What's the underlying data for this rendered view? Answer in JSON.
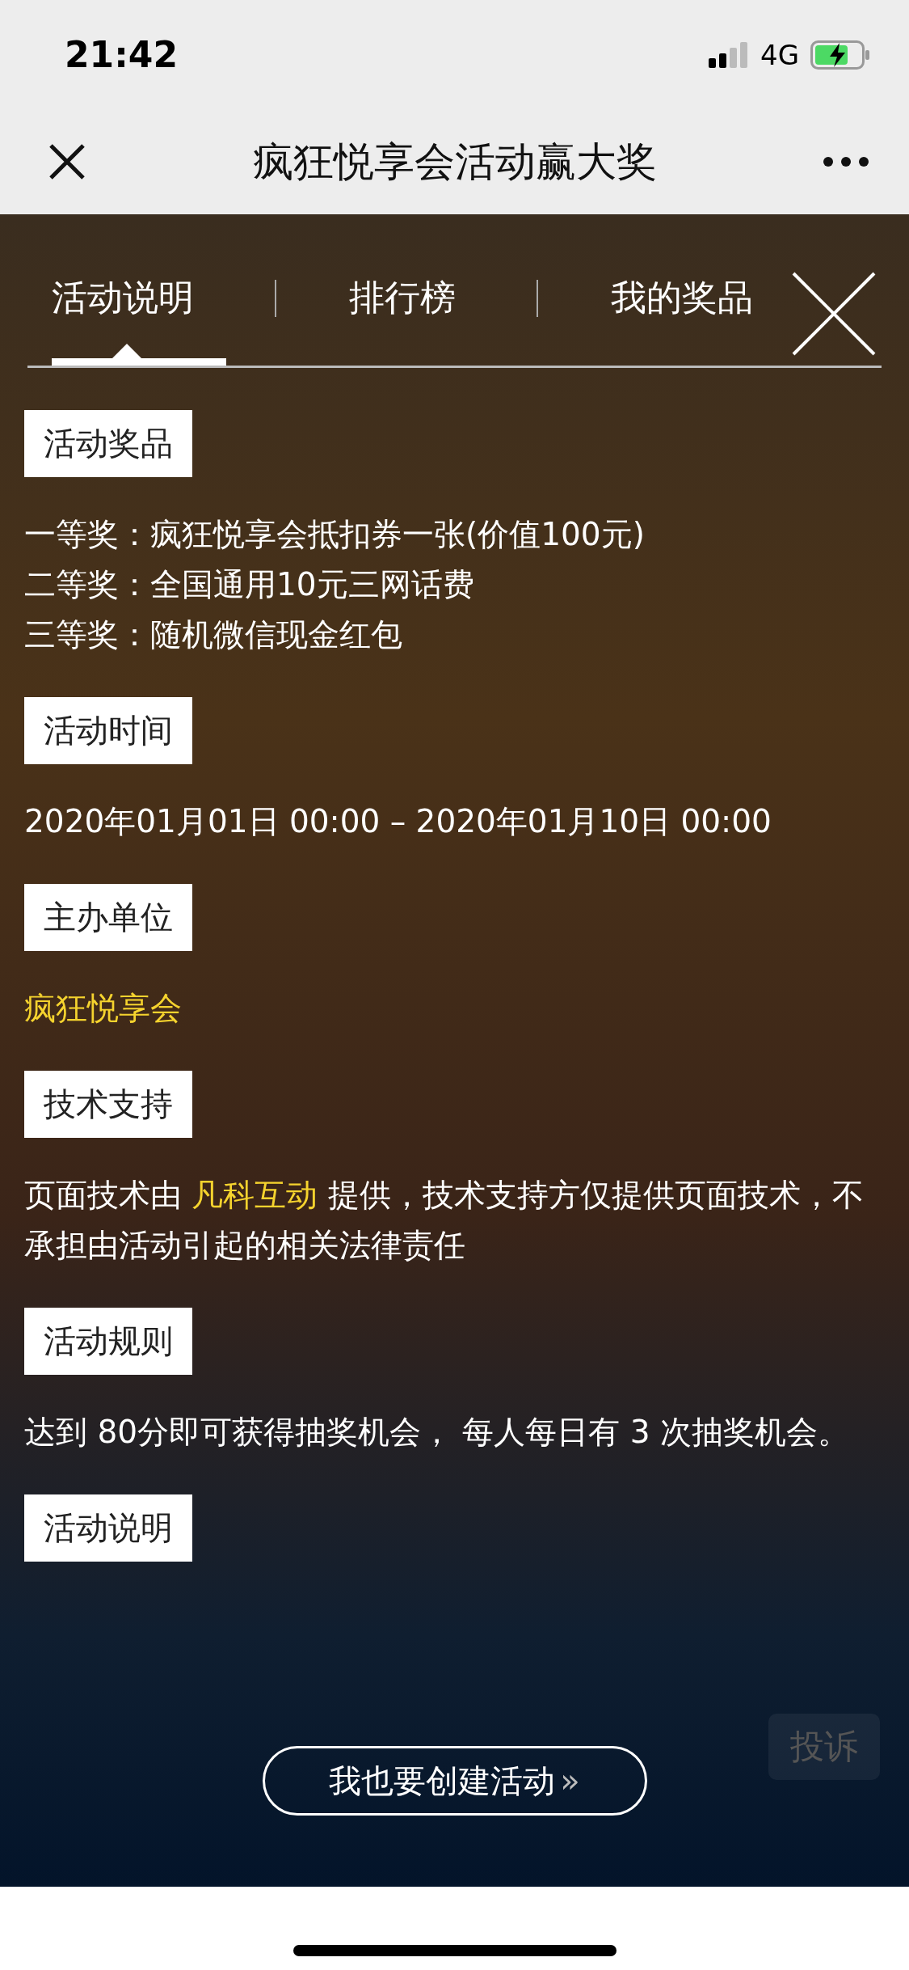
{
  "status_bar": {
    "time": "21:42",
    "network": "4G"
  },
  "nav": {
    "title": "疯狂悦享会活动赢大奖"
  },
  "tabs": [
    {
      "label": "活动说明",
      "selected": true
    },
    {
      "label": "排行榜",
      "selected": false
    },
    {
      "label": "我的奖品",
      "selected": false
    }
  ],
  "sections": [
    {
      "title": "活动奖品",
      "kind": "lines",
      "lines": [
        "一等奖：疯狂悦享会抵扣券一张(价值100元)",
        "二等奖：全国通用10元三网话费",
        "三等奖：随机微信现金红包"
      ]
    },
    {
      "title": "活动时间",
      "kind": "lines",
      "lines": [
        "2020年01月01日 00:00 – 2020年01月10日 00:00"
      ]
    },
    {
      "title": "主办单位",
      "kind": "highlight",
      "text": "疯狂悦享会"
    },
    {
      "title": "技术支持",
      "kind": "link_text",
      "before": "页面技术由 ",
      "link": "凡科互动",
      "after": " 提供，技术支持方仅提供页面技术，不承担由活动引起的相关法律责任"
    },
    {
      "title": "活动规则",
      "kind": "lines",
      "lines": [
        "达到 80分即可获得抽奖机会， 每人每日有 3 次抽奖机会。"
      ]
    },
    {
      "title": "活动说明",
      "kind": "empty"
    }
  ],
  "create_button": {
    "label": "我也要创建活动",
    "arrow": "»"
  },
  "complaint_button": {
    "label": "投诉"
  }
}
